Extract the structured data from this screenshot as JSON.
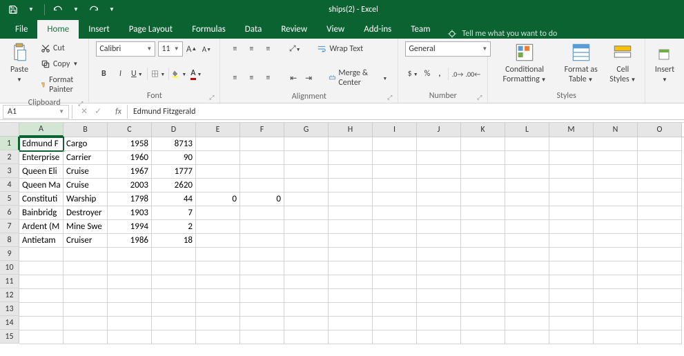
{
  "app": {
    "title": "ships(2)  -  Excel"
  },
  "tabs": [
    "File",
    "Home",
    "Insert",
    "Page Layout",
    "Formulas",
    "Data",
    "Review",
    "View",
    "Add-ins",
    "Team"
  ],
  "activeTab": "Home",
  "tellMe": "Tell me what you want to do",
  "clipboard": {
    "paste": "Paste",
    "cut": "Cut",
    "copy": "Copy",
    "formatPainter": "Format Painter",
    "group": "Clipboard"
  },
  "font": {
    "name": "Calibri",
    "size": "11",
    "group": "Font"
  },
  "alignment": {
    "wrap": "Wrap Text",
    "merge": "Merge & Center",
    "group": "Alignment"
  },
  "number": {
    "format": "General",
    "group": "Number"
  },
  "styles": {
    "cond": "Conditional Formatting",
    "table": "Format as Table",
    "cell": "Cell Styles",
    "group": "Styles"
  },
  "cells": {
    "insert": "Insert"
  },
  "nameBox": "A1",
  "formula": "Edmund Fitzgerald",
  "columns": [
    "A",
    "B",
    "C",
    "D",
    "E",
    "F",
    "G",
    "H",
    "I",
    "J",
    "K",
    "L",
    "M",
    "N",
    "O"
  ],
  "rows": [
    1,
    2,
    3,
    4,
    5,
    6,
    7,
    8,
    9,
    10,
    11,
    12,
    13,
    14,
    15
  ],
  "cellsData": {
    "1": {
      "A": "Edmund F",
      "B": "Cargo",
      "C": "1958",
      "D": "8713"
    },
    "2": {
      "A": "Enterprise",
      "B": "Carrier",
      "C": "1960",
      "D": "90"
    },
    "3": {
      "A": "Queen Eli",
      "B": "Cruise",
      "C": "1967",
      "D": "1777"
    },
    "4": {
      "A": "Queen Ma",
      "B": "Cruise",
      "C": "2003",
      "D": "2620"
    },
    "5": {
      "A": "Constituti",
      "B": "Warship",
      "C": "1798",
      "D": "44",
      "E": "0",
      "F": "0"
    },
    "6": {
      "A": "Bainbridg",
      "B": "Destroyer",
      "C": "1903",
      "D": "7"
    },
    "7": {
      "A": "Ardent (M",
      "B": "Mine Swe",
      "C": "1994",
      "D": "2"
    },
    "8": {
      "A": "Antietam",
      "B": "Cruiser",
      "C": "1986",
      "D": "18"
    }
  },
  "numericCols": [
    "C",
    "D",
    "E",
    "F"
  ],
  "selectedCell": {
    "row": 1,
    "col": "A"
  }
}
